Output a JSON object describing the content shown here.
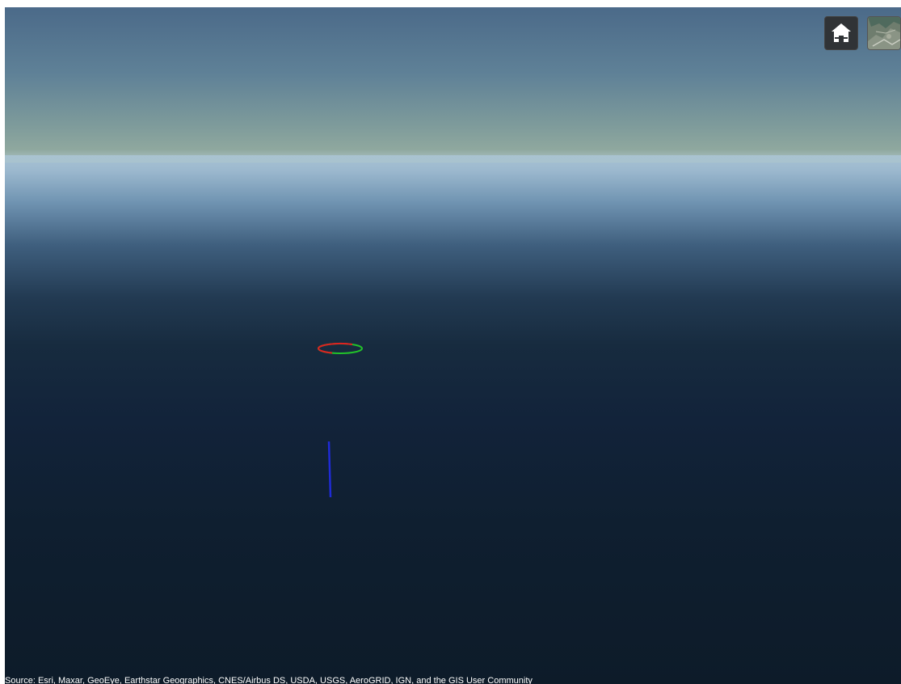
{
  "viewer": {
    "colors": {
      "sky_top": "#4b6a89",
      "horizon": "#a9c3d4",
      "ground": "#0d1b29"
    },
    "overlays": {
      "ellipse_red": "#e02020",
      "ellipse_green": "#22c22a",
      "vertical_line": "#1f2bd6"
    }
  },
  "toolbar": {
    "home_icon": "home-icon",
    "basemap_icon": "basemap-thumbnail-icon"
  },
  "attribution": {
    "text": "Source: Esri, Maxar, GeoEye, Earthstar Geographics, CNES/Airbus DS, USDA, USGS, AeroGRID, IGN, and the GIS User Community"
  }
}
